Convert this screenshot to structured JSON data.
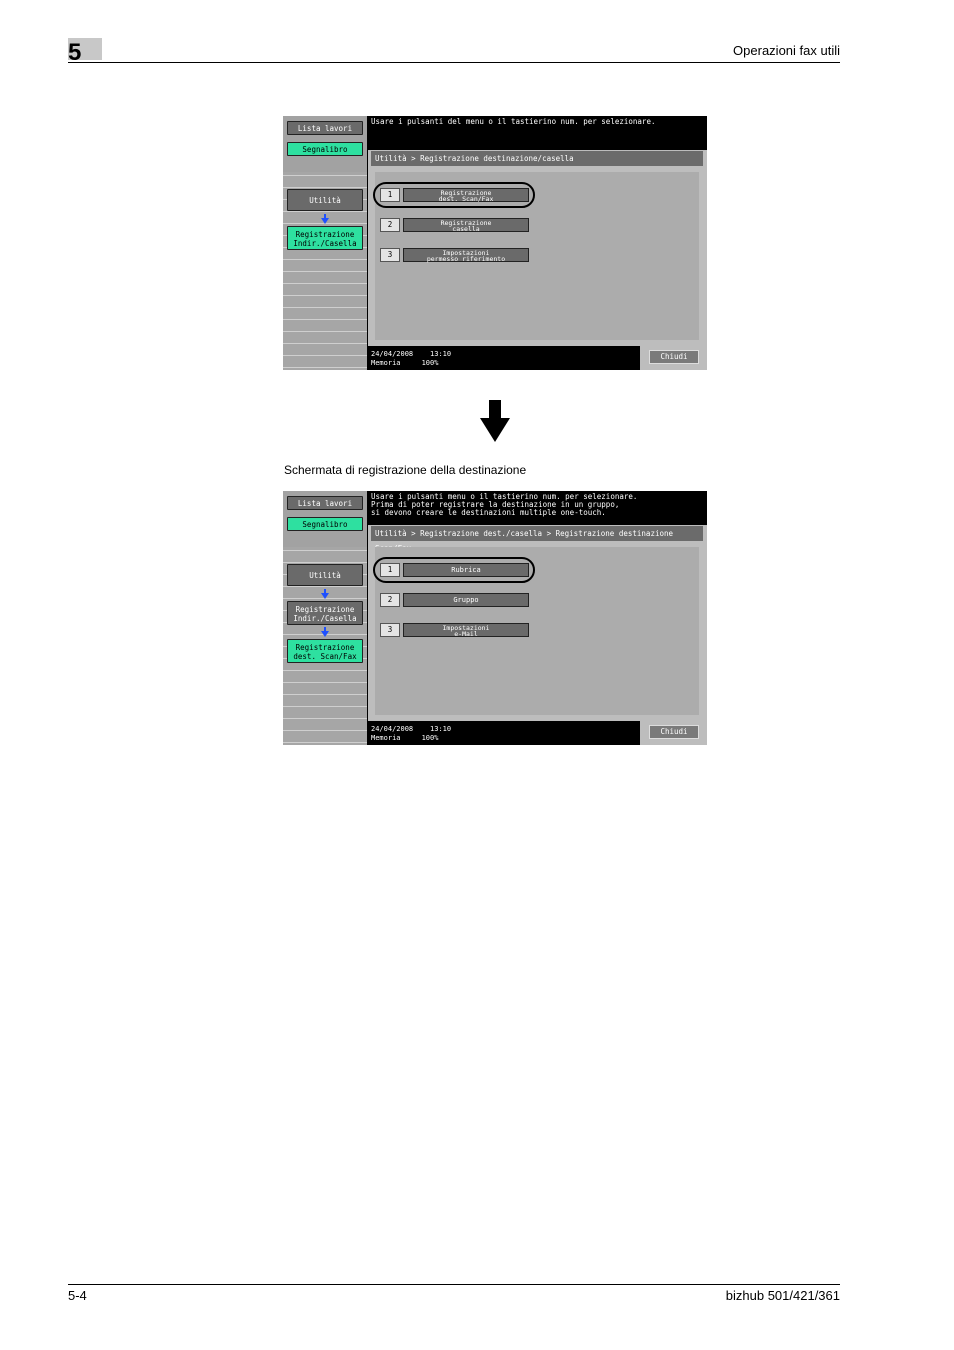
{
  "header": {
    "chapter_number": "5",
    "title": "Operazioni fax utili"
  },
  "footer": {
    "page": "5-4",
    "product": "bizhub 501/421/361"
  },
  "caption": "Schermata di registrazione della destinazione",
  "screen1": {
    "sidebar": {
      "job_list": "Lista lavori",
      "bookmark": "Segnalibro",
      "utility": "Utilità",
      "step2": [
        "Registrazione",
        "Indir./Casella"
      ]
    },
    "message": "Usare i pulsanti del menu o il tastierino num. per selezionare.",
    "breadcrumb": "Utilità > Registrazione destinazione/casella",
    "options": [
      {
        "num": "1",
        "line1": "Registrazione",
        "line2": "dest. Scan/Fax"
      },
      {
        "num": "2",
        "line1": "Registrazione",
        "line2": "casella"
      },
      {
        "num": "3",
        "line1": "Impostazioni",
        "line2": "permesso riferimento"
      }
    ],
    "date": "24/04/2008",
    "time": "13:10",
    "memory_label": "Memoria",
    "memory_value": "100%",
    "close": "Chiudi"
  },
  "screen2": {
    "sidebar": {
      "job_list": "Lista lavori",
      "bookmark": "Segnalibro",
      "utility": "Utilità",
      "step2": [
        "Registrazione",
        "Indir./Casella"
      ],
      "step3": [
        "Registrazione",
        "dest. Scan/Fax"
      ]
    },
    "message_lines": [
      "Usare i pulsanti menu o il tastierino num. per selezionare.",
      "Prima di poter registrare la destinazione in un gruppo,",
      "si devono creare le destinazioni multiple one-touch."
    ],
    "breadcrumb": "Utilità > Registrazione dest./casella > Registrazione destinazione Scan/Fax",
    "options": [
      {
        "num": "1",
        "line1": "Rubrica",
        "line2": ""
      },
      {
        "num": "2",
        "line1": "Gruppo",
        "line2": ""
      },
      {
        "num": "3",
        "line1": "Impostazioni",
        "line2": "e-Mail"
      }
    ],
    "date": "24/04/2008",
    "time": "13:10",
    "memory_label": "Memoria",
    "memory_value": "100%",
    "close": "Chiudi"
  },
  "colors": {
    "accent_green": "#2ee0a0",
    "button_gray": "#6a6a6a",
    "arrow_blue": "#1e50ff"
  },
  "icons": {
    "flow_arrow": "down-arrow-icon",
    "side_arrow": "blue-down-arrow-icon"
  }
}
